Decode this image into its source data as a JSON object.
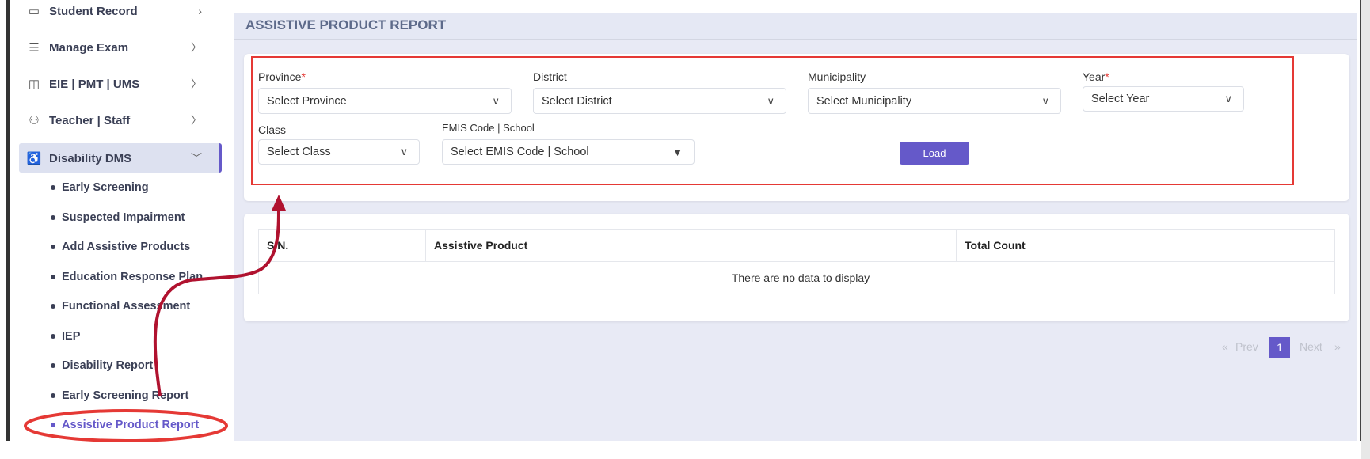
{
  "sidebar": {
    "items": [
      {
        "label": "Student Record",
        "icon": "file-icon"
      },
      {
        "label": "Manage Exam",
        "icon": "list-icon"
      },
      {
        "label": "EIE | PMT | UMS",
        "icon": "book-icon"
      },
      {
        "label": "Teacher | Staff",
        "icon": "users-icon"
      },
      {
        "label": "Disability DMS",
        "icon": "wheelchair-icon"
      }
    ],
    "sub_items": [
      "Early Screening",
      "Suspected Impairment",
      "Add Assistive Products",
      "Education Response Plan",
      "Functional Assessment",
      "IEP",
      "Disability Report",
      "Early Screening Report",
      "Assistive Product Report"
    ]
  },
  "page": {
    "title": "ASSISTIVE PRODUCT REPORT"
  },
  "filters": {
    "province": {
      "label": "Province",
      "required": "*",
      "value": "Select Province"
    },
    "district": {
      "label": "District",
      "value": "Select District"
    },
    "municipality": {
      "label": "Municipality",
      "value": "Select Municipality"
    },
    "year": {
      "label": "Year",
      "required": "*",
      "value": "Select Year"
    },
    "class": {
      "label": "Class",
      "value": "Select Class"
    },
    "emis": {
      "label": "EMIS Code | School",
      "value": "Select EMIS Code | School"
    },
    "load_label": "Load"
  },
  "table": {
    "columns": [
      "S.N.",
      "Assistive Product",
      "Total Count"
    ],
    "empty_message": "There are no data to display"
  },
  "pagination": {
    "first": "«",
    "prev": "Prev",
    "current": "1",
    "next": "Next",
    "last": "»"
  },
  "colors": {
    "accent": "#6559c9",
    "annotation": "#e53935"
  }
}
